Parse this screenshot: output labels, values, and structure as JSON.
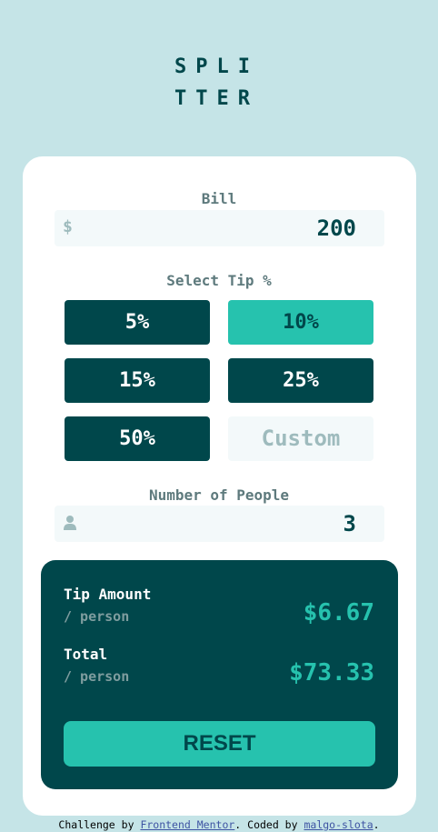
{
  "app": {
    "logo": "SPLITTER"
  },
  "bill": {
    "label": "Bill",
    "currency_symbol": "$",
    "value": "200"
  },
  "tip": {
    "label": "Select Tip %",
    "options": [
      "5%",
      "10%",
      "15%",
      "25%",
      "50%"
    ],
    "selected": "10%",
    "custom_placeholder": "Custom"
  },
  "people": {
    "label": "Number of People",
    "value": "3",
    "icon": "person-icon"
  },
  "results": {
    "tip_title": "Tip Amount",
    "tip_sub": "/ person",
    "tip_value": "$6.67",
    "total_title": "Total",
    "total_sub": "/ person",
    "total_value": "$73.33",
    "reset_label": "RESET"
  },
  "attribution": {
    "prefix": "Challenge by ",
    "link1": "Frontend Mentor",
    "middle": ". Coded by ",
    "link2": "malgo-slota",
    "suffix": "."
  },
  "colors": {
    "background": "#c5e4e7",
    "dark_cyan": "#00474b",
    "strong_cyan": "#26c2ae",
    "grayish_cyan": "#5e7a7d",
    "light_field": "#f3f9fa"
  }
}
